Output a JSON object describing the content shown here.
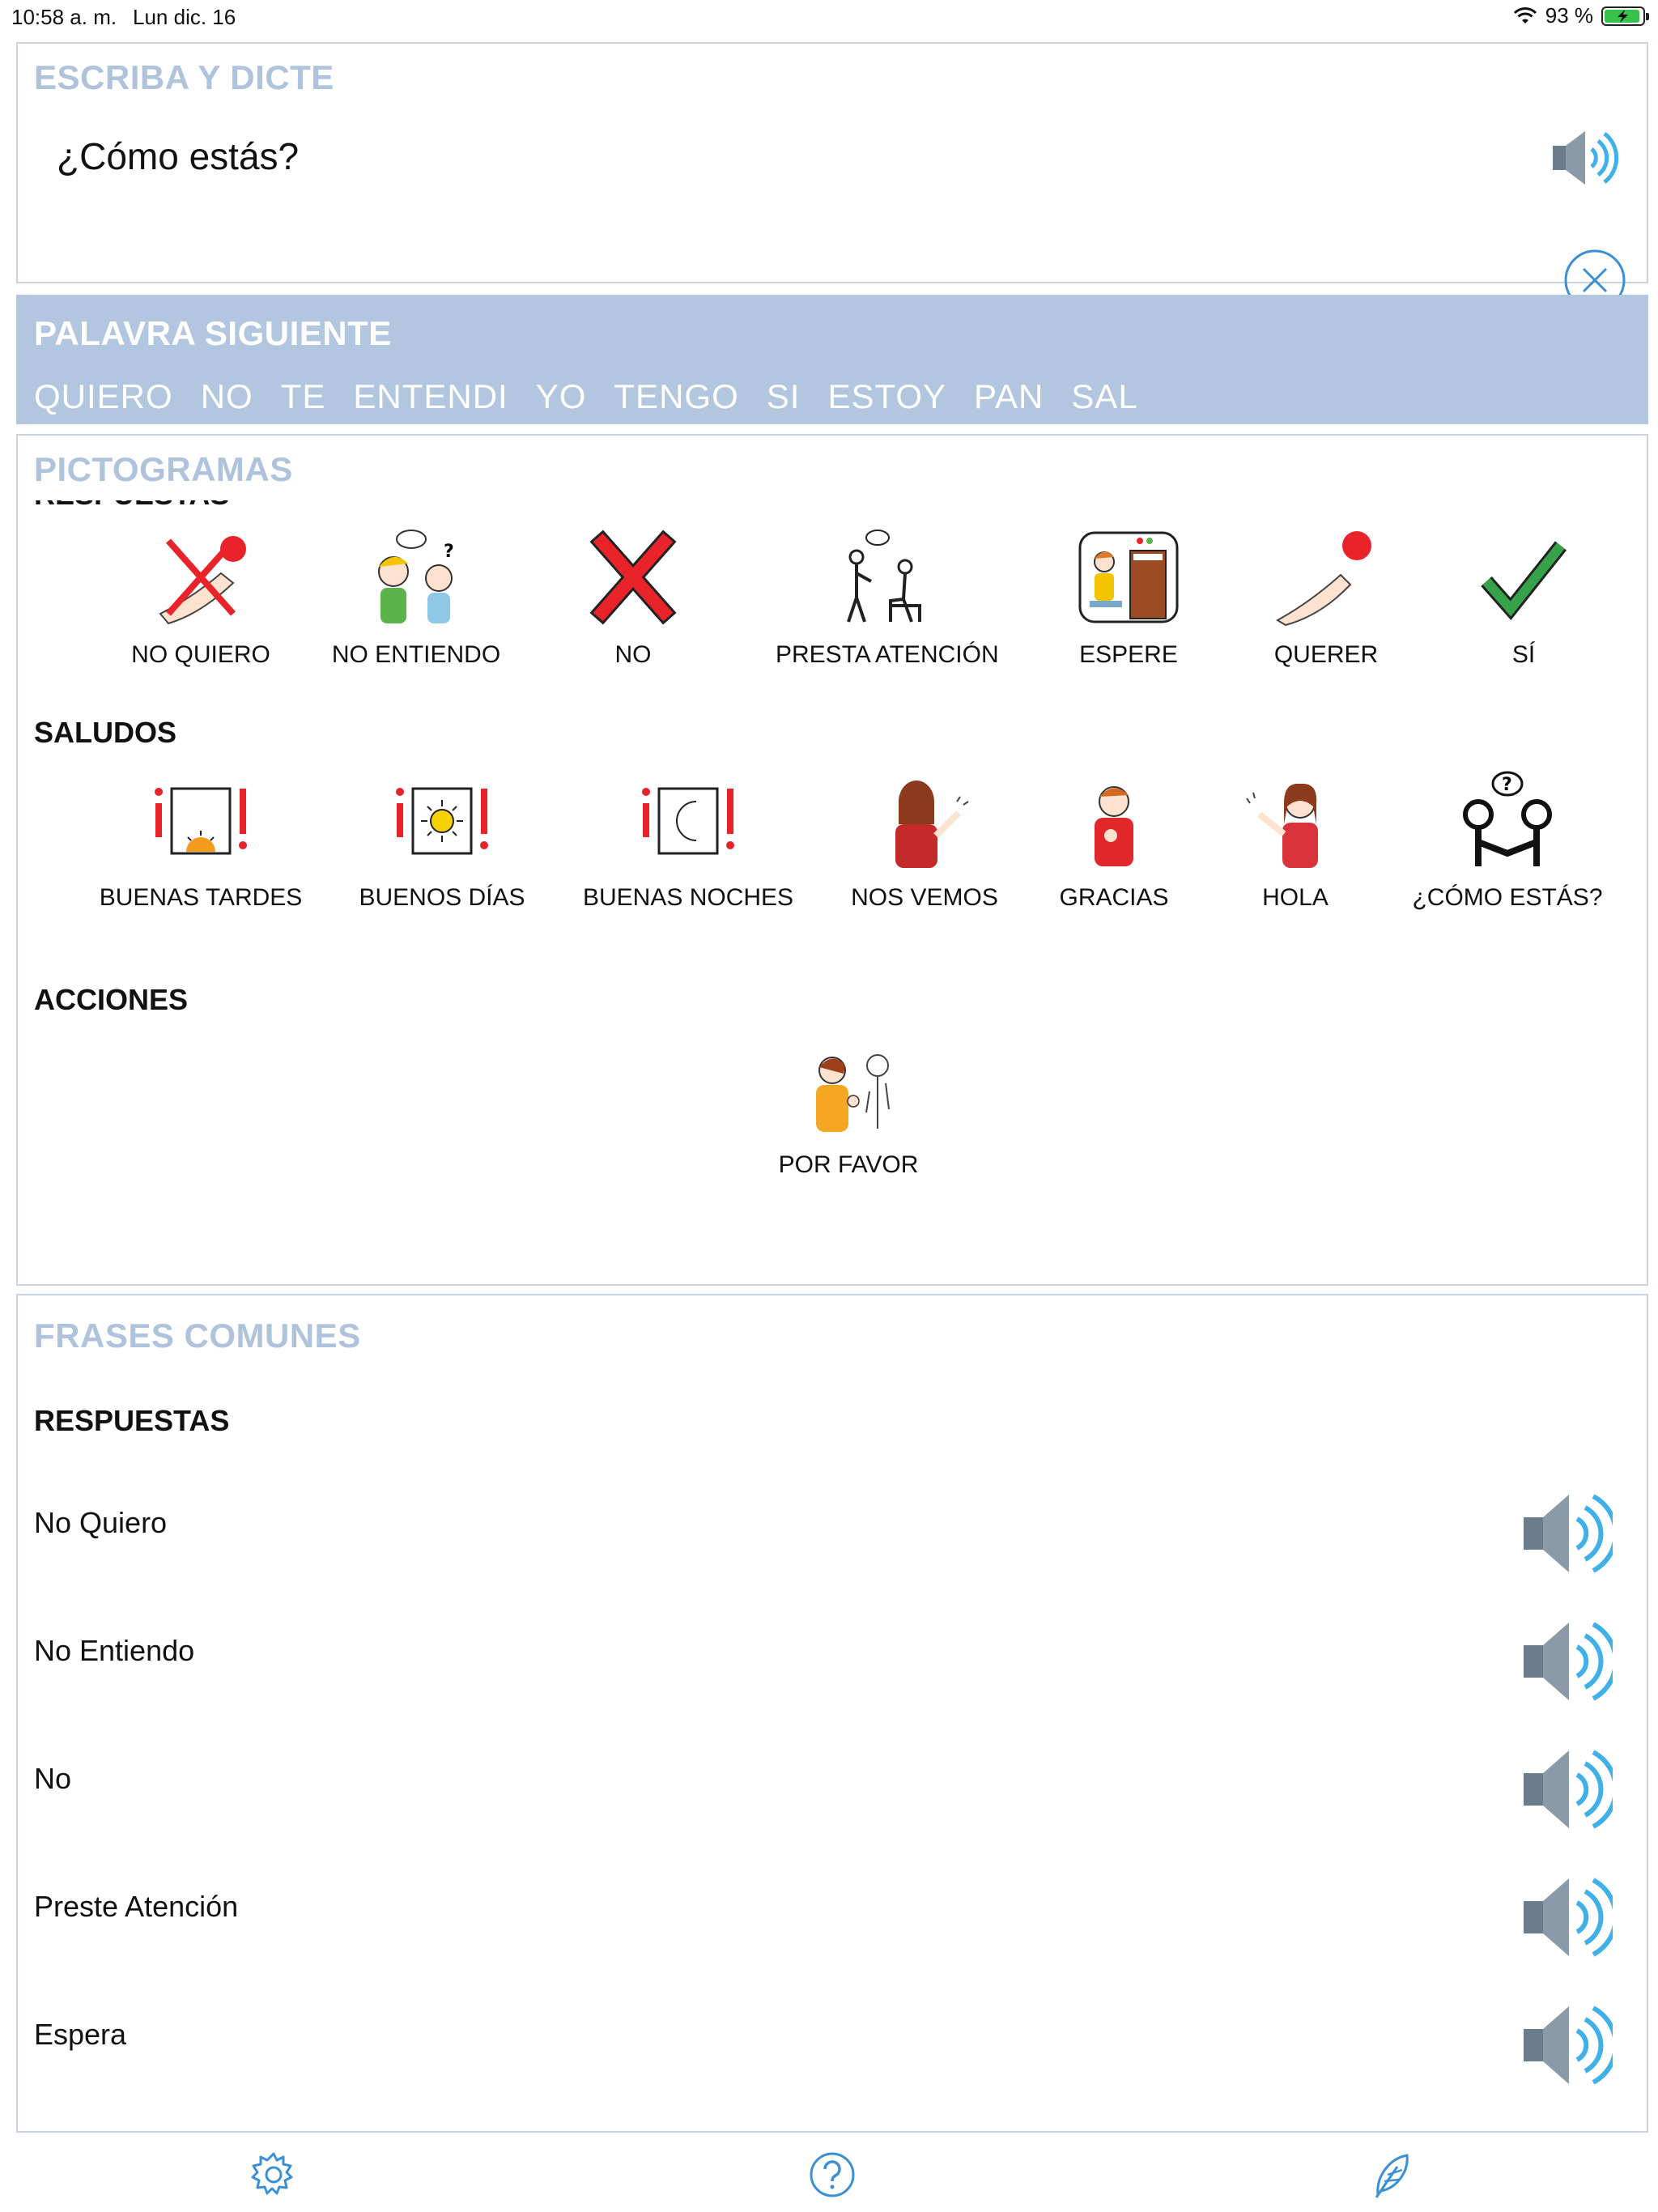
{
  "status": {
    "time": "10:58 a. m.",
    "date": "Lun dic. 16",
    "battery": "93 %",
    "battery_level": 0.93
  },
  "dictate": {
    "title": "ESCRIBA Y DICTE",
    "text": "¿Cómo estás?"
  },
  "next_word": {
    "title": "PALAVRA SIGUIENTE",
    "words": [
      "QUIERO",
      "NO",
      "TE",
      "ENTENDI",
      "YO",
      "TENGO",
      "SI",
      "ESTOY",
      "PAN",
      "SAL"
    ]
  },
  "pictograms": {
    "title": "PICTOGRAMAS",
    "sections": [
      {
        "heading": "RESPUESTAS",
        "items": [
          {
            "label": "NO QUIERO",
            "icon": "hand-cross-icon"
          },
          {
            "label": "NO ENTIENDO",
            "icon": "confused-people-icon"
          },
          {
            "label": "NO",
            "icon": "red-x-icon"
          },
          {
            "label": "PRESTA ATENCIÓN",
            "icon": "attention-icon"
          },
          {
            "label": "ESPERE",
            "icon": "waiting-room-icon"
          },
          {
            "label": "QUERER",
            "icon": "hand-reach-icon"
          },
          {
            "label": "SÍ",
            "icon": "checkmark-icon"
          }
        ]
      },
      {
        "heading": "SALUDOS",
        "items": [
          {
            "label": "BUENAS TARDES",
            "icon": "sunset-icon"
          },
          {
            "label": "BUENOS DÍAS",
            "icon": "sun-icon"
          },
          {
            "label": "BUENAS NOCHES",
            "icon": "moon-icon"
          },
          {
            "label": "NOS VEMOS",
            "icon": "wave-goodbye-icon"
          },
          {
            "label": "GRACIAS",
            "icon": "thanks-icon"
          },
          {
            "label": "HOLA",
            "icon": "wave-hello-icon"
          },
          {
            "label": "¿CÓMO ESTÁS?",
            "icon": "handshake-icon"
          }
        ]
      },
      {
        "heading": "ACCIONES",
        "items": [
          {
            "label": "POR FAVOR",
            "icon": "please-icon"
          }
        ]
      }
    ]
  },
  "phrases": {
    "title": "FRASES COMUNES",
    "section": "RESPUESTAS",
    "items": [
      "No Quiero",
      "No Entiendo",
      "No",
      "Preste Atención",
      "Espera"
    ]
  },
  "tabbar": {
    "items": [
      "gear-icon",
      "help-icon",
      "feather-icon"
    ]
  },
  "colors": {
    "accent": "#b2c6df",
    "title_gray": "#b0c3dc",
    "icon_blue": "#3b8fd4"
  }
}
